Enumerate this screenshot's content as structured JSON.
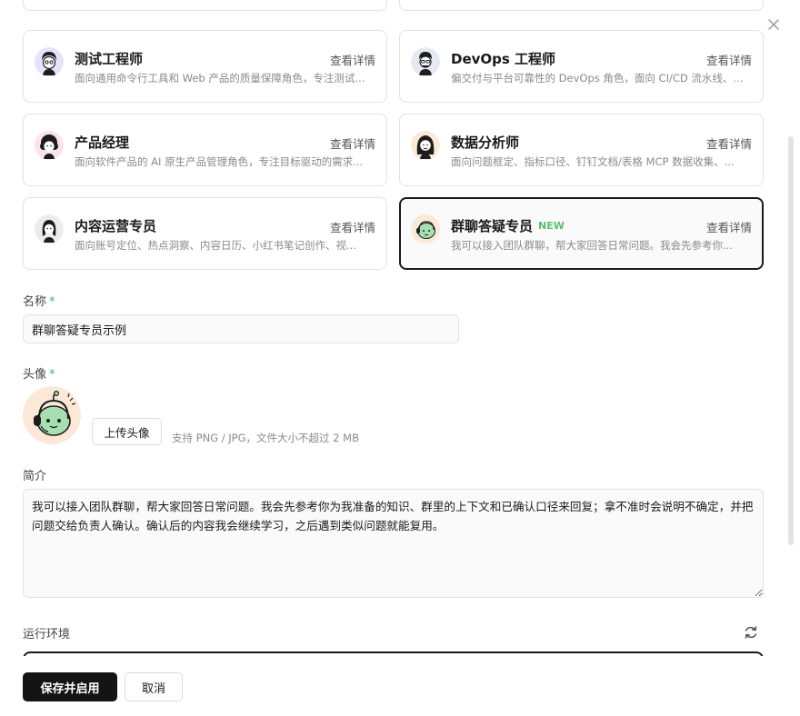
{
  "dialog": {
    "close_icon": "close-icon",
    "roles": [
      {
        "title": "测试工程师",
        "detail": "查看详情",
        "desc": "面向通用命令行工具和 Web 产品的质量保障角色，专注测试...",
        "avatar_color": "#e7e2fb"
      },
      {
        "title": "DevOps 工程师",
        "detail": "查看详情",
        "desc": "偏交付与平台可靠性的 DevOps 角色，面向 CI/CD 流水线、...",
        "avatar_color": "#e5e9f2"
      },
      {
        "title": "产品经理",
        "detail": "查看详情",
        "desc": "面向软件产品的 AI 原生产品管理角色，专注目标驱动的需求...",
        "avatar_color": "#fbe3e7"
      },
      {
        "title": "数据分析师",
        "detail": "查看详情",
        "desc": "面向问题框定、指标口径、钉钉文档/表格 MCP 数据收集、...",
        "avatar_color": "#f8ead6"
      },
      {
        "title": "内容运营专员",
        "detail": "查看详情",
        "desc": "面向账号定位、热点洞察、内容日历、小红书笔记创作、视...",
        "avatar_color": "#ececec"
      },
      {
        "title": "群聊答疑专员",
        "badge": "NEW",
        "detail": "查看详情",
        "desc": "我可以接入团队群聊，帮大家回答日常问题。我会先参考你...",
        "avatar_color": "#fbe8d7"
      }
    ],
    "name": {
      "label": "名称",
      "required_mark": "*",
      "value": "群聊答疑专员示例"
    },
    "avatar": {
      "label": "头像",
      "required_mark": "*",
      "upload_label": "上传头像",
      "hint": "支持 PNG / JPG，文件大小不超过 2 MB"
    },
    "bio": {
      "label": "简介",
      "value": "我可以接入团队群聊，帮大家回答日常问题。我会先参考你为我准备的知识、群里的上下文和已确认口径来回复；拿不准时会说明不确定，并把问题交给负责人确认。确认后的内容我会继续学习，之后遇到类似问题就能复用。"
    },
    "runtime": {
      "label": "运行环境",
      "refresh_icon": "refresh-icon"
    },
    "footer": {
      "save_label": "保存并启用",
      "cancel_label": "取消"
    },
    "colors": {
      "accent": "#141414",
      "required": "#3fb36c",
      "new_badge": "#5cbf6a",
      "bot_green": "#a8dfb0"
    }
  }
}
